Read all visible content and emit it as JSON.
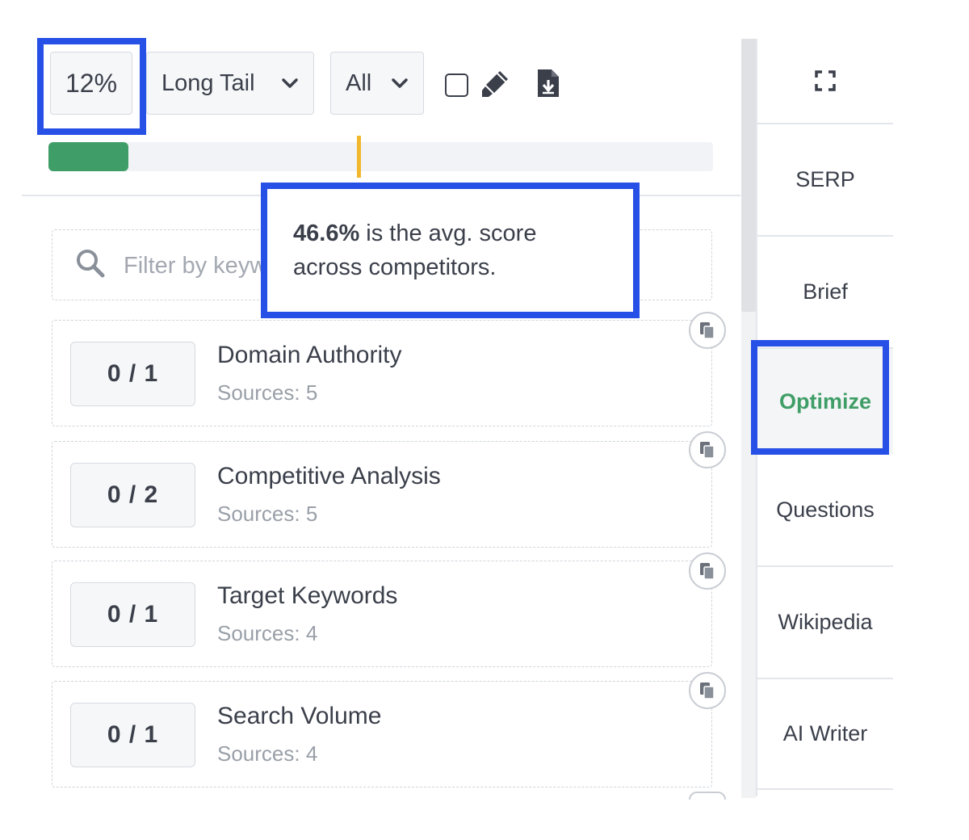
{
  "toolbar": {
    "score": "12%",
    "keyword_type_select": "Long Tail",
    "filter_select": "All",
    "checkbox_checked": false,
    "icons": [
      "chevron-down-icon",
      "pen-icon",
      "file-download-icon"
    ]
  },
  "progress": {
    "current_fraction": 0.12,
    "avg_marker_fraction": 0.466,
    "fill_color": "#3f9e67",
    "marker_color": "#f2b72d"
  },
  "tooltip": {
    "value": "46.6%",
    "text_line1": " is the avg. score",
    "text_line2": "across competitors."
  },
  "filter": {
    "placeholder": "Filter by keyword",
    "value": ""
  },
  "topics": [
    {
      "count": "0 / 1",
      "title": "Domain Authority",
      "sources": "Sources: 5"
    },
    {
      "count": "0 / 2",
      "title": "Competitive Analysis",
      "sources": "Sources: 5"
    },
    {
      "count": "0 / 1",
      "title": "Target Keywords",
      "sources": "Sources: 4"
    },
    {
      "count": "0 / 1",
      "title": "Search Volume",
      "sources": "Sources: 4"
    }
  ],
  "nav": {
    "items": [
      "SERP",
      "Brief",
      "Optimize",
      "Questions",
      "Wikipedia",
      "AI Writer"
    ],
    "active": "Optimize",
    "active_color": "#3f9e67"
  },
  "highlight_color": "#2750e6"
}
